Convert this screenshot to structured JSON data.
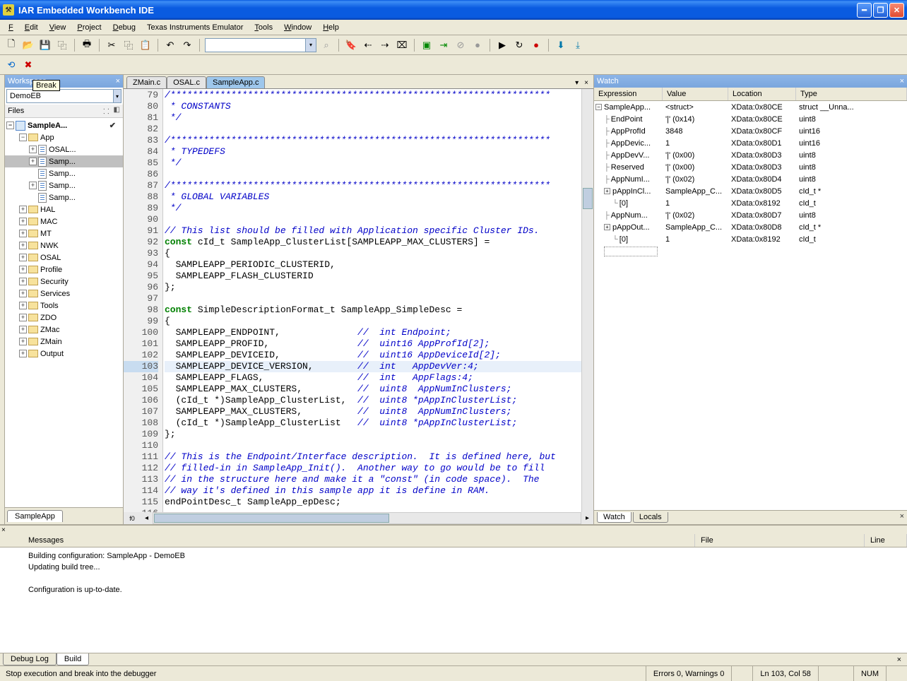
{
  "titlebar": {
    "title": "IAR Embedded Workbench IDE"
  },
  "menu": {
    "file": "File",
    "edit": "Edit",
    "view": "View",
    "project": "Project",
    "debug": "Debug",
    "ti": "Texas Instruments Emulator",
    "tools": "Tools",
    "window": "Window",
    "help": "Help"
  },
  "tooltip": "Break",
  "workspace": {
    "title": "Workspace",
    "config": "DemoEB",
    "files_label": "Files",
    "bottom_tab": "SampleApp",
    "root": "SampleA...",
    "nodes": [
      {
        "level": 1,
        "exp": "-",
        "type": "folder",
        "label": "App"
      },
      {
        "level": 2,
        "exp": "+",
        "type": "file",
        "label": "OSAL..."
      },
      {
        "level": 2,
        "exp": "+",
        "type": "file",
        "label": "Samp...",
        "selected": true
      },
      {
        "level": 2,
        "exp": " ",
        "type": "file",
        "label": "Samp..."
      },
      {
        "level": 2,
        "exp": "+",
        "type": "file",
        "label": "Samp..."
      },
      {
        "level": 2,
        "exp": " ",
        "type": "file",
        "label": "Samp..."
      },
      {
        "level": 1,
        "exp": "+",
        "type": "folder",
        "label": "HAL"
      },
      {
        "level": 1,
        "exp": "+",
        "type": "folder",
        "label": "MAC"
      },
      {
        "level": 1,
        "exp": "+",
        "type": "folder",
        "label": "MT"
      },
      {
        "level": 1,
        "exp": "+",
        "type": "folder",
        "label": "NWK"
      },
      {
        "level": 1,
        "exp": "+",
        "type": "folder",
        "label": "OSAL"
      },
      {
        "level": 1,
        "exp": "+",
        "type": "folder",
        "label": "Profile"
      },
      {
        "level": 1,
        "exp": "+",
        "type": "folder",
        "label": "Security"
      },
      {
        "level": 1,
        "exp": "+",
        "type": "folder",
        "label": "Services"
      },
      {
        "level": 1,
        "exp": "+",
        "type": "folder",
        "label": "Tools"
      },
      {
        "level": 1,
        "exp": "+",
        "type": "folder",
        "label": "ZDO"
      },
      {
        "level": 1,
        "exp": "+",
        "type": "folder",
        "label": "ZMac"
      },
      {
        "level": 1,
        "exp": "+",
        "type": "folder",
        "label": "ZMain"
      },
      {
        "level": 1,
        "exp": "+",
        "type": "folder",
        "label": "Output"
      }
    ]
  },
  "editor": {
    "tabs": [
      {
        "label": "ZMain.c",
        "active": false
      },
      {
        "label": "OSAL.c",
        "active": false
      },
      {
        "label": "SampleApp.c",
        "active": true
      }
    ],
    "first_line": 79,
    "highlight_line": 103,
    "lines": [
      {
        "cls": "cmt",
        "text": "/*********************************************************************"
      },
      {
        "cls": "cmt",
        "text": " * CONSTANTS"
      },
      {
        "cls": "cmt",
        "text": " */"
      },
      {
        "cls": "",
        "text": ""
      },
      {
        "cls": "cmt",
        "text": "/*********************************************************************"
      },
      {
        "cls": "cmt",
        "text": " * TYPEDEFS"
      },
      {
        "cls": "cmt",
        "text": " */"
      },
      {
        "cls": "",
        "text": ""
      },
      {
        "cls": "cmt",
        "text": "/*********************************************************************"
      },
      {
        "cls": "cmt",
        "text": " * GLOBAL VARIABLES"
      },
      {
        "cls": "cmt",
        "text": " */"
      },
      {
        "cls": "",
        "text": ""
      },
      {
        "cls": "cmt",
        "text": "// This list should be filled with Application specific Cluster IDs."
      },
      {
        "cls": "",
        "text": "",
        "parts": [
          {
            "t": "const",
            "c": "kw"
          },
          {
            "t": " cId_t SampleApp_ClusterList[SAMPLEAPP_MAX_CLUSTERS] ="
          }
        ]
      },
      {
        "cls": "",
        "text": "{"
      },
      {
        "cls": "",
        "text": "  SAMPLEAPP_PERIODIC_CLUSTERID,"
      },
      {
        "cls": "",
        "text": "  SAMPLEAPP_FLASH_CLUSTERID"
      },
      {
        "cls": "",
        "text": "};"
      },
      {
        "cls": "",
        "text": ""
      },
      {
        "cls": "",
        "text": "",
        "parts": [
          {
            "t": "const",
            "c": "kw"
          },
          {
            "t": " SimpleDescriptionFormat_t SampleApp_SimpleDesc ="
          }
        ]
      },
      {
        "cls": "",
        "text": "{"
      },
      {
        "cls": "",
        "text": "",
        "parts": [
          {
            "t": "  SAMPLEAPP_ENDPOINT,              "
          },
          {
            "t": "//  int Endpoint;",
            "c": "cmt"
          }
        ]
      },
      {
        "cls": "",
        "text": "",
        "parts": [
          {
            "t": "  SAMPLEAPP_PROFID,                "
          },
          {
            "t": "//  uint16 AppProfId[2];",
            "c": "cmt"
          }
        ]
      },
      {
        "cls": "",
        "text": "",
        "parts": [
          {
            "t": "  SAMPLEAPP_DEVICEID,              "
          },
          {
            "t": "//  uint16 AppDeviceId[2];",
            "c": "cmt"
          }
        ]
      },
      {
        "cls": "",
        "text": "",
        "parts": [
          {
            "t": "  SAMPLEAPP_DEVICE_VERSION,        "
          },
          {
            "t": "//  int   AppDevVer:4;",
            "c": "cmt"
          }
        ]
      },
      {
        "cls": "",
        "text": "",
        "parts": [
          {
            "t": "  SAMPLEAPP_FLAGS,                 "
          },
          {
            "t": "//  int   AppFlags:4;",
            "c": "cmt"
          }
        ]
      },
      {
        "cls": "",
        "text": "",
        "parts": [
          {
            "t": "  SAMPLEAPP_MAX_CLUSTERS,          "
          },
          {
            "t": "//  uint8  AppNumInClusters;",
            "c": "cmt"
          }
        ]
      },
      {
        "cls": "",
        "text": "",
        "parts": [
          {
            "t": "  (cId_t *)SampleApp_ClusterList,  "
          },
          {
            "t": "//  uint8 *pAppInClusterList;",
            "c": "cmt"
          }
        ]
      },
      {
        "cls": "",
        "text": "",
        "parts": [
          {
            "t": "  SAMPLEAPP_MAX_CLUSTERS,          "
          },
          {
            "t": "//  uint8  AppNumInClusters;",
            "c": "cmt"
          }
        ]
      },
      {
        "cls": "",
        "text": "",
        "parts": [
          {
            "t": "  (cId_t *)SampleApp_ClusterList   "
          },
          {
            "t": "//  uint8 *pAppInClusterList;",
            "c": "cmt"
          }
        ]
      },
      {
        "cls": "",
        "text": "};"
      },
      {
        "cls": "",
        "text": ""
      },
      {
        "cls": "cmt",
        "text": "// This is the Endpoint/Interface description.  It is defined here, but"
      },
      {
        "cls": "cmt",
        "text": "// filled-in in SampleApp_Init().  Another way to go would be to fill"
      },
      {
        "cls": "cmt",
        "text": "// in the structure here and make it a \"const\" (in code space).  The"
      },
      {
        "cls": "cmt",
        "text": "// way it's defined in this sample app it is define in RAM."
      },
      {
        "cls": "",
        "text": "endPointDesc_t SampleApp_epDesc;"
      },
      {
        "cls": "",
        "text": ""
      }
    ],
    "fn_label": "f0"
  },
  "watch": {
    "title": "Watch",
    "headers": {
      "exp": "Expression",
      "val": "Value",
      "loc": "Location",
      "typ": "Type"
    },
    "rows": [
      {
        "ind": 0,
        "box": "-",
        "name": "SampleApp...",
        "val": "<struct>",
        "loc": "XData:0x80CE",
        "typ": "struct __Unna..."
      },
      {
        "ind": 1,
        "box": "",
        "name": "EndPoint",
        "val": "'|' (0x14)",
        "loc": "XData:0x80CE",
        "typ": "uint8"
      },
      {
        "ind": 1,
        "box": "",
        "name": "AppProfId",
        "val": "3848",
        "loc": "XData:0x80CF",
        "typ": "uint16"
      },
      {
        "ind": 1,
        "box": "",
        "name": "AppDevic...",
        "val": "1",
        "loc": "XData:0x80D1",
        "typ": "uint16"
      },
      {
        "ind": 1,
        "box": "",
        "name": "AppDevV...",
        "val": "'|' (0x00)",
        "loc": "XData:0x80D3",
        "typ": "uint8"
      },
      {
        "ind": 1,
        "box": "",
        "name": "Reserved",
        "val": "'|' (0x00)",
        "loc": "XData:0x80D3",
        "typ": "uint8"
      },
      {
        "ind": 1,
        "box": "",
        "name": "AppNumI...",
        "val": "'|' (0x02)",
        "loc": "XData:0x80D4",
        "typ": "uint8"
      },
      {
        "ind": 1,
        "box": "+",
        "name": "pAppInCl...",
        "val": "SampleApp_C...",
        "loc": "XData:0x80D5",
        "typ": "cId_t *"
      },
      {
        "ind": 2,
        "box": "",
        "name": "[0]",
        "val": "1",
        "loc": "XData:0x8192",
        "typ": "cId_t"
      },
      {
        "ind": 1,
        "box": "",
        "name": "AppNum...",
        "val": "'|' (0x02)",
        "loc": "XData:0x80D7",
        "typ": "uint8"
      },
      {
        "ind": 1,
        "box": "+",
        "name": "pAppOut...",
        "val": "SampleApp_C...",
        "loc": "XData:0x80D8",
        "typ": "cId_t *"
      },
      {
        "ind": 2,
        "box": "",
        "name": "[0]",
        "val": "1",
        "loc": "XData:0x8192",
        "typ": "cId_t"
      }
    ],
    "tab_watch": "Watch",
    "tab_locals": "Locals"
  },
  "build": {
    "headers": {
      "msg": "Messages",
      "file": "File",
      "line": "Line"
    },
    "lines": [
      "Building configuration: SampleApp - DemoEB",
      "Updating build tree...",
      "",
      "Configuration is up-to-date."
    ],
    "tab_debug": "Debug Log",
    "tab_build": "Build"
  },
  "status": {
    "hint": "Stop execution and break into the debugger",
    "errs": "Errors 0, Warnings 0",
    "pos": "Ln 103, Col 58",
    "num": "NUM"
  }
}
